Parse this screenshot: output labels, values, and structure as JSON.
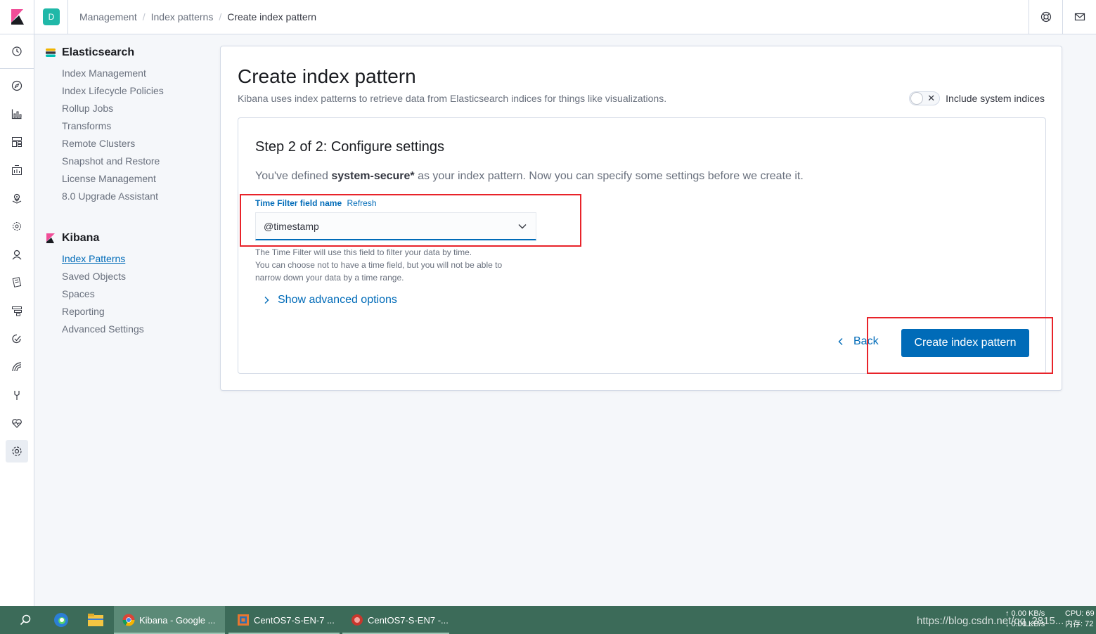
{
  "header": {
    "space_initial": "D",
    "breadcrumbs": [
      "Management",
      "Index patterns",
      "Create index pattern"
    ]
  },
  "sidenav": {
    "elasticsearch": {
      "title": "Elasticsearch",
      "items": [
        "Index Management",
        "Index Lifecycle Policies",
        "Rollup Jobs",
        "Transforms",
        "Remote Clusters",
        "Snapshot and Restore",
        "License Management",
        "8.0 Upgrade Assistant"
      ]
    },
    "kibana": {
      "title": "Kibana",
      "items": [
        "Index Patterns",
        "Saved Objects",
        "Spaces",
        "Reporting",
        "Advanced Settings"
      ],
      "active_item": "Index Patterns"
    }
  },
  "rail_icons": [
    "clock-icon",
    "compass-icon",
    "visualize-icon",
    "dashboard-icon",
    "canvas-icon",
    "maps-icon",
    "ml-icon",
    "metrics-icon",
    "logs-icon",
    "apm-icon",
    "uptime-icon",
    "siem-icon",
    "dev-tools-icon",
    "monitoring-icon",
    "management-gear-icon"
  ],
  "main": {
    "title": "Create index pattern",
    "description": "Kibana uses index patterns to retrieve data from Elasticsearch indices for things like visualizations.",
    "include_system_label": "Include system indices",
    "include_system_on": false,
    "step": {
      "title": "Step 2 of 2: Configure settings",
      "desc_prefix": "You've defined ",
      "pattern": "system-secure*",
      "desc_suffix": " as your index pattern. Now you can specify some settings before we create it.",
      "field_label": "Time Filter field name",
      "refresh_label": "Refresh",
      "selected_field": "@timestamp",
      "help_lines": [
        "The Time Filter will use this field to filter your data by time.",
        "You can choose not to have a time field, but you will not be able to",
        "narrow down your data by a time range."
      ],
      "advanced_label": "Show advanced options",
      "back_label": "Back",
      "create_label": "Create index pattern"
    }
  },
  "taskbar": {
    "apps": [
      {
        "label": "Kibana - Google ...",
        "active": true
      },
      {
        "label": "CentOS7-S-EN-7 ...",
        "active": false
      },
      {
        "label": "CentOS7-S-EN7 -...",
        "active": false
      }
    ],
    "watermark": "https://blog.csdn.net/qq_2815...",
    "net_up": "↑ 0.00 KB/s",
    "net_down": "↓ 0.00 KB/s",
    "cpu": "CPU: 69",
    "mem": "内存: 72"
  },
  "colors": {
    "accent": "#006bb8",
    "annotation": "#e8232a",
    "taskbar": "#3c6b59"
  }
}
